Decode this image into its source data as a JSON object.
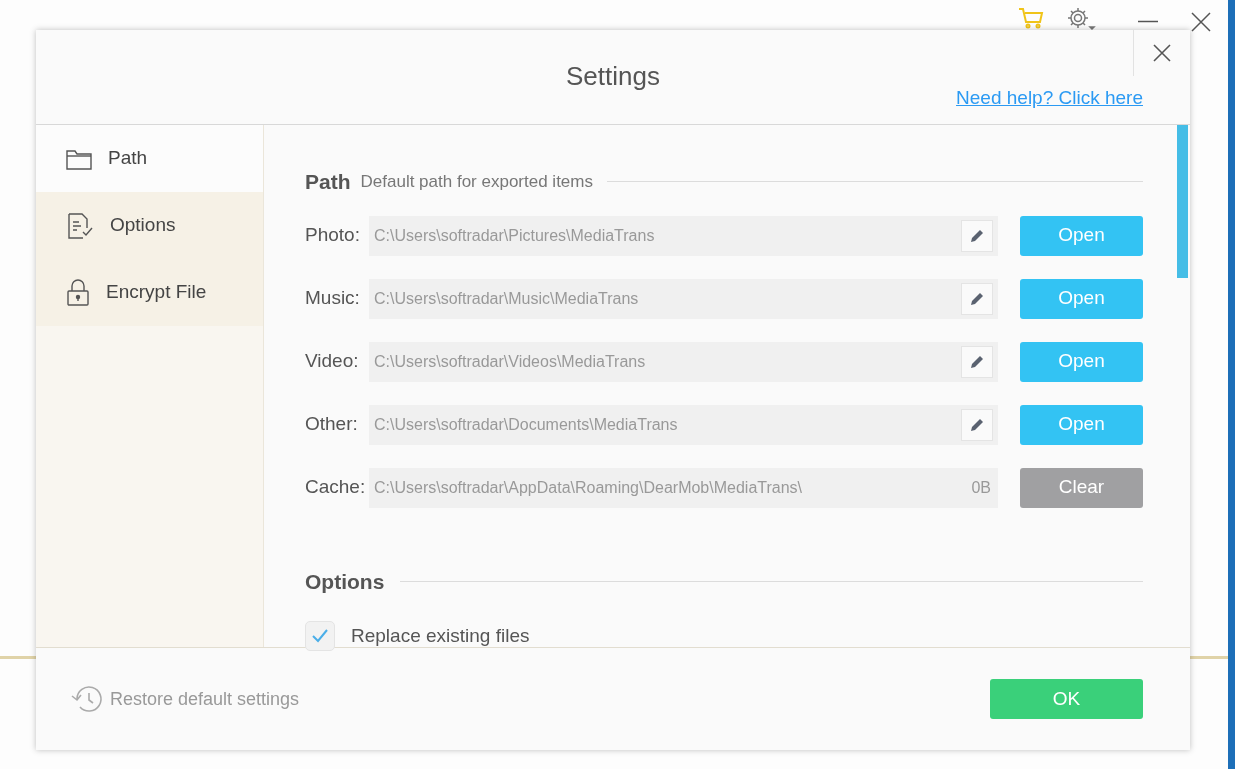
{
  "dialog": {
    "title": "Settings",
    "help_link": "Need help? Click here"
  },
  "sidebar": {
    "items": [
      {
        "label": "Path",
        "selected": true
      },
      {
        "label": "Options",
        "selected": false
      },
      {
        "label": "Encrypt File",
        "selected": false
      }
    ]
  },
  "path_section": {
    "title": "Path",
    "subtitle": "Default path for exported items",
    "rows": [
      {
        "kind": "path",
        "label": "Photo:",
        "value": "C:\\Users\\softradar\\Pictures\\MediaTrans",
        "button": "Open"
      },
      {
        "kind": "path",
        "label": "Music:",
        "value": "C:\\Users\\softradar\\Music\\MediaTrans",
        "button": "Open"
      },
      {
        "kind": "path",
        "label": "Video:",
        "value": "C:\\Users\\softradar\\Videos\\MediaTrans",
        "button": "Open"
      },
      {
        "kind": "path",
        "label": "Other:",
        "value": "C:\\Users\\softradar\\Documents\\MediaTrans",
        "button": "Open"
      },
      {
        "kind": "cache",
        "label": "Cache:",
        "value": "C:\\Users\\softradar\\AppData\\Roaming\\DearMob\\MediaTrans\\",
        "size": "0B",
        "button": "Clear"
      }
    ]
  },
  "options_section": {
    "title": "Options",
    "items": [
      {
        "label": "Replace existing files",
        "checked": true
      }
    ]
  },
  "footer": {
    "restore": "Restore default settings",
    "ok": "OK"
  }
}
